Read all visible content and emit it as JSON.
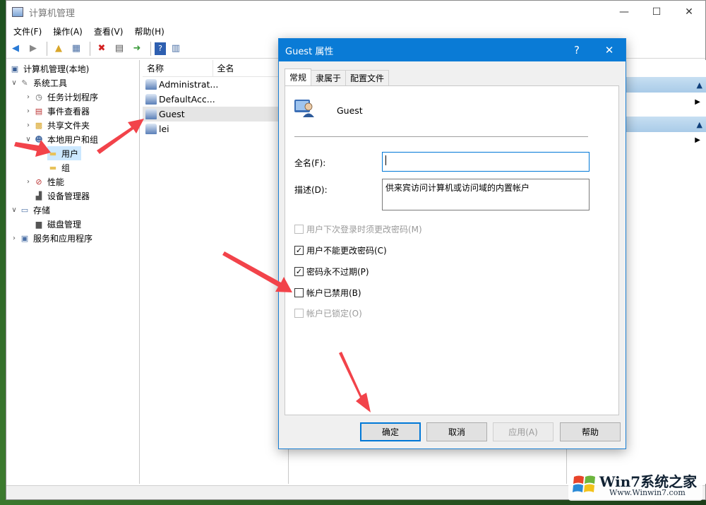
{
  "window": {
    "title": "计算机管理"
  },
  "menu": [
    "文件(F)",
    "操作(A)",
    "查看(V)",
    "帮助(H)"
  ],
  "tree": [
    {
      "label": "计算机管理(本地)",
      "level": 0,
      "arrow": ""
    },
    {
      "label": "系统工具",
      "level": 1,
      "arrow": "v"
    },
    {
      "label": "任务计划程序",
      "level": 2,
      "arrow": ">"
    },
    {
      "label": "事件查看器",
      "level": 2,
      "arrow": ">"
    },
    {
      "label": "共享文件夹",
      "level": 2,
      "arrow": ">"
    },
    {
      "label": "本地用户和组",
      "level": 2,
      "arrow": "v"
    },
    {
      "label": "用户",
      "level": 3,
      "arrow": "",
      "selected": true
    },
    {
      "label": "组",
      "level": 3,
      "arrow": ""
    },
    {
      "label": "性能",
      "level": 2,
      "arrow": ">"
    },
    {
      "label": "设备管理器",
      "level": 2,
      "arrow": ""
    },
    {
      "label": "存储",
      "level": 1,
      "arrow": "v"
    },
    {
      "label": "磁盘管理",
      "level": 2,
      "arrow": ""
    },
    {
      "label": "服务和应用程序",
      "level": 1,
      "arrow": ">"
    }
  ],
  "list": {
    "headers": [
      "名称",
      "全名"
    ],
    "rows": [
      "Administrat...",
      "DefaultAcc...",
      "Guest",
      "lei"
    ]
  },
  "dialog": {
    "title": "Guest 属性",
    "help": "?",
    "close": "✕",
    "tabs": [
      "常规",
      "隶属于",
      "配置文件"
    ],
    "username": "Guest",
    "fullname_label": "全名(F):",
    "fullname_value": "",
    "desc_label": "描述(D):",
    "desc_value": "供来宾访问计算机或访问域的内置帐户",
    "checkboxes": [
      {
        "label": "用户下次登录时须更改密码(M)",
        "checked": false,
        "disabled": true
      },
      {
        "label": "用户不能更改密码(C)",
        "checked": true,
        "disabled": false
      },
      {
        "label": "密码永不过期(P)",
        "checked": true,
        "disabled": false
      },
      {
        "label": "帐户已禁用(B)",
        "checked": false,
        "disabled": false
      },
      {
        "label": "帐户已锁定(O)",
        "checked": false,
        "disabled": true
      }
    ],
    "buttons": {
      "ok": "确定",
      "cancel": "取消",
      "apply": "应用(A)",
      "help": "帮助"
    }
  },
  "watermark": {
    "main": "Win7系统之家",
    "sub": "Www.Winwin7.com"
  },
  "colors": {
    "accent": "#0a7bd6",
    "annotation_arrow": "#f2434a",
    "selection": "#cce8ff"
  }
}
